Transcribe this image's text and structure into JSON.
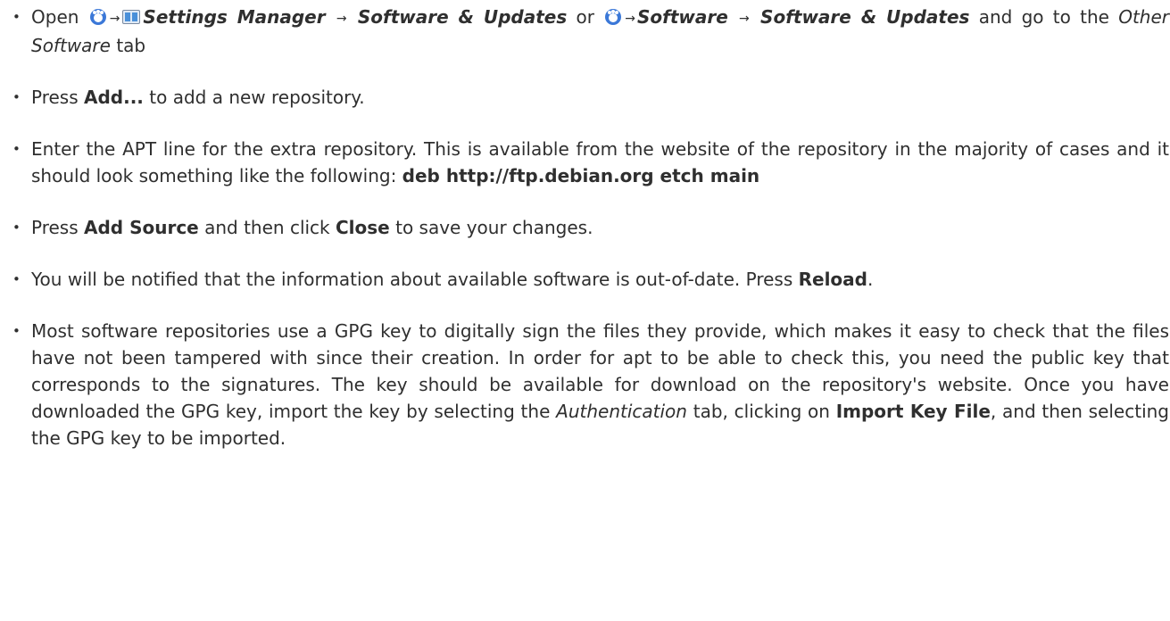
{
  "steps": {
    "s1": {
      "open": "Open",
      "settings_manager": "Settings Manager",
      "software_updates_1": "Software & Updates",
      "or": "or",
      "software": "Software",
      "software_updates_2": "Software & Updates",
      "go_to": "and go to the",
      "tab_name": "Other Software",
      "tab": "tab"
    },
    "s2": {
      "pre": "Press",
      "button": "Add...",
      "post": "to add a new repository."
    },
    "s3": {
      "text": "Enter the APT line for the extra repository. This is available from the website of the repository in the majority of cases and it should look something like the following:",
      "apt_line": "deb http://ftp.debian.org etch main"
    },
    "s4": {
      "pre": "Press",
      "button1": "Add Source",
      "mid": "and then click",
      "button2": "Close",
      "post": "to save your changes."
    },
    "s5": {
      "pre": "You will be notified that the information about available software is out-of-date. Press",
      "button": "Reload",
      "post": "."
    },
    "s6": {
      "pre": "Most software repositories use a GPG key to digitally sign the files they provide, which makes it easy to check that the files have not been tampered with since their creation. In order for apt to be able to check this, you need the public key that corresponds to the signatures. The key should be available for download on the repository's website. Once you have downloaded the GPG key, import the key by selecting the",
      "tab_name": "Authentication",
      "mid": "tab, clicking on",
      "button": "Import Key File",
      "post": ", and then selecting the GPG key to be imported."
    }
  },
  "arrow": "→",
  "colors": {
    "text": "#2f2f2f",
    "menu_icon": "#3b78d8",
    "settings_icon": "#4a90d9"
  },
  "icons": {
    "menu": "whisker-menu-icon",
    "settings": "settings-manager-icon"
  }
}
